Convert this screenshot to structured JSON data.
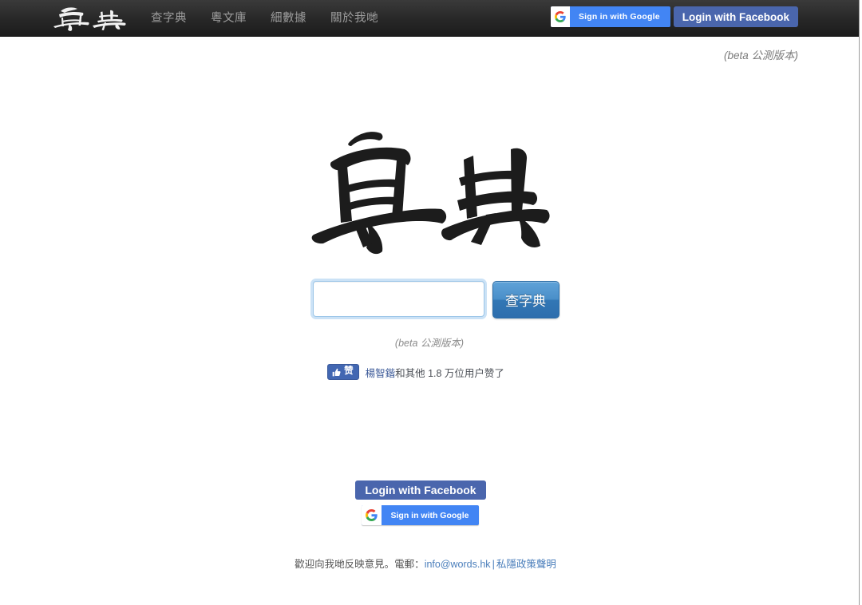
{
  "navbar": {
    "brand_label": "粵典",
    "brand_icon": "yuedin-calligraphy-logo",
    "links": [
      {
        "label": "查字典"
      },
      {
        "label": "粵文庫"
      },
      {
        "label": "細數據"
      },
      {
        "label": "關於我哋"
      }
    ],
    "google_button": {
      "label": "Sign in with Google",
      "icon": "google-g-icon",
      "bg_color": "#4285F4"
    },
    "facebook_button": {
      "label": "Login with Facebook",
      "bg_color": "#4A66AD"
    },
    "bg_color": "#272727"
  },
  "beta_top": "(beta 公測版本)",
  "hero": {
    "logo_label": "粵典",
    "logo_icon": "yuedin-brush-logo"
  },
  "search": {
    "value": "",
    "placeholder": "",
    "button_label": "查字典",
    "button_color": "#3277B5"
  },
  "beta_mid": "(beta 公測版本)",
  "facebook_like": {
    "button_label": "赞",
    "button_icon": "thumbs-up-icon",
    "button_color": "#4267B2",
    "social_text_name": "楊智鍇",
    "social_text_rest": "和其他 1.8 万位用户赞了"
  },
  "bottom_auth": {
    "facebook_label": "Login with Facebook",
    "google_label": "Sign in with Google",
    "google_icon": "google-g-icon"
  },
  "footer": {
    "text": "歡迎向我哋反映意見。電郵：",
    "email": "info@words.hk",
    "separator": "|",
    "privacy_label": "私隱政策聲明",
    "link_color": "#4A7EBB"
  }
}
